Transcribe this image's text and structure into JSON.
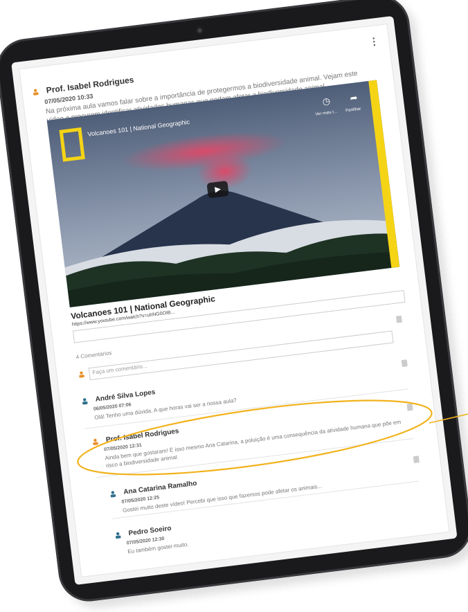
{
  "post": {
    "author": "Prof. Isabel Rodrigues",
    "date": "07/05/2020 10:33",
    "text": "Na próxima aula vamos falar sobre a importância de protegermos a biodiversidade animal. Vejam este vídeo e procurem identificar atividades humanas que podem afetar a biodiversidade animal."
  },
  "video": {
    "overlay_title": "Volcanoes 101 | National Geographic",
    "watch_later_label": "Ver mais t...",
    "share_label": "Partilhar"
  },
  "link": {
    "title": "Volcanoes 101 | National Geographic",
    "url": "https://www.youtube.com/watch?v=uhNG0OIB..."
  },
  "comments_count_label": "4 Comentários",
  "comment_input_placeholder": "Faça um comentário...",
  "comments": [
    {
      "author": "André Silva Lopes",
      "date": "06/05/2020 07:06",
      "text": "Olá! Tenho uma dúvida. A que horas vai ser a nossa aula?"
    },
    {
      "author": "Prof. Isabel Rodrigues",
      "date": "07/05/2020 12:31",
      "text": "Ainda bem que gostaram! É isso mesmo Ana Catarina, a poluição é uma consequência da atividade humana que põe em risco a biodiversidade animal."
    },
    {
      "author": "Ana Catarina Ramalho",
      "date": "07/05/2020 12:25",
      "text": "Gostei muito deste vídeo! Percebi que isso que fazemos pode afetar os animais..."
    },
    {
      "author": "Pedro Soeiro",
      "date": "07/05/2020 12:30",
      "text": "Eu também gostei muito."
    }
  ],
  "colors": {
    "teacher_icon": "#e8902a",
    "student_icon": "#2f6f8c",
    "highlight": "#f2b21c",
    "ng_yellow": "#f5d416"
  }
}
